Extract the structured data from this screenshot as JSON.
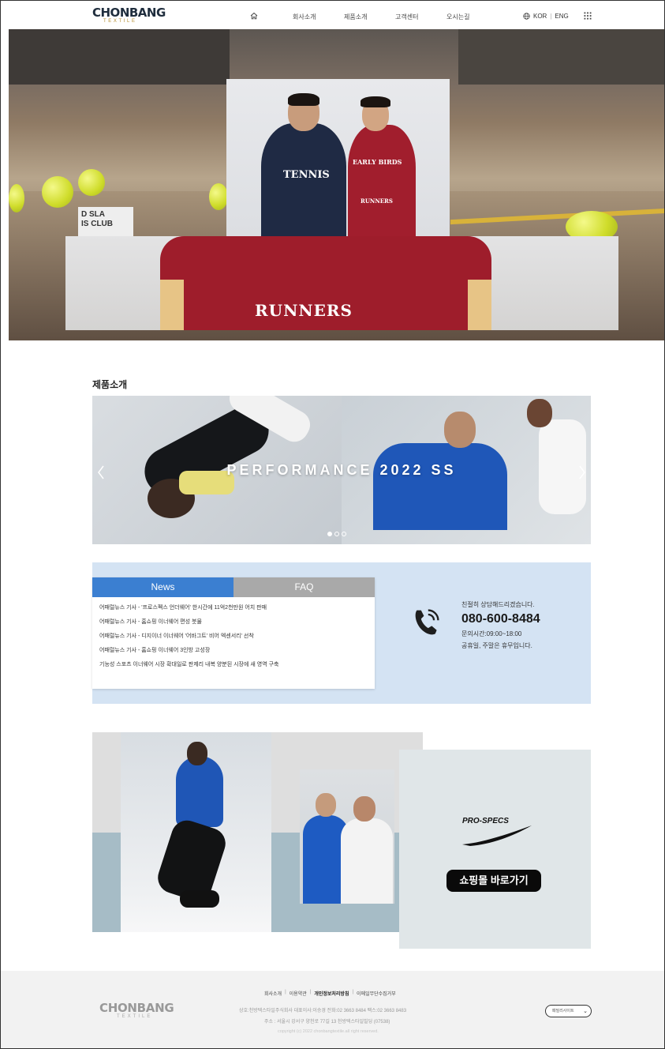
{
  "header": {
    "logo_main": "CHONBANG",
    "logo_sub": "TEXTILE",
    "nav": [
      "회사소개",
      "제품소개",
      "고객센터",
      "오시는길"
    ],
    "lang_kor": "KOR",
    "lang_sep": "|",
    "lang_eng": "ENG"
  },
  "hero": {
    "shirt_left": "TENNIS",
    "shirt_right": "EARLY BIRDS",
    "shirt_right_sub": "RUNNERS",
    "lower_text": "RUNNERS",
    "sign_text": "D SLA\nIS CLUB"
  },
  "products": {
    "title": "제품소개",
    "slide_caption": "PERFORMANCE 2022 SS",
    "dot_count": 3,
    "active_dot": 0
  },
  "news": {
    "tab_news": "News",
    "tab_faq": "FAQ",
    "items": [
      "어패럴뉴스 기사 - '프로스펙스 언더웨어' 한시간에 11억2천만원 어치 판매",
      "어패럴뉴스 기사 - 홈쇼핑 이너웨어 편성 붓물",
      "어패럴뉴스 기사 - 디지이너 이너웨어 '어바그트' 비어 엑센서리' 선착",
      "어패럴뉴스 기사 - 홈쇼핑 이너웨어 3인방 고성장",
      "기능성 스포츠 이너웨어 시장 확대일로 판제리 내복 양분된 시장에 새 영역 구축"
    ]
  },
  "contact": {
    "lead": "친절히 상담해드리겠습니다.",
    "phone": "080-600-8484",
    "hours": "문의시간:09:00~18:00",
    "closed": "공휴일, 주말은 휴무입니다."
  },
  "brand": {
    "logo_text": "PRO-SPECS",
    "shop_button": "쇼핑몰 바로가기"
  },
  "footer": {
    "logo_main": "CHONBANG",
    "logo_sub": "TEXTILE",
    "links": [
      "회사소개",
      "이용약관",
      "개인정보처리방침",
      "이메일무단수집거부"
    ],
    "address_line1": "상호:천방텍스타일주식회사   대표이사:이승경   전화:02 3663 8484   팩스:02 3663 8483",
    "address_line2": "주소 : 서울시 강서구 양천로 77길 13 천방텍스타일빌딩 (07538)",
    "copyright": "copyright (c) 2022 chonbangtextile.all right reserved.",
    "family_site": "패밀리사이트"
  }
}
